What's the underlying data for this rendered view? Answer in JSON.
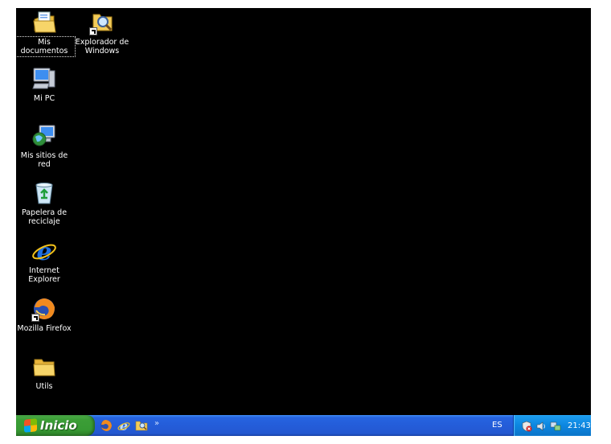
{
  "desktop": {
    "icons": [
      {
        "label": "Mis documentos",
        "icon": "my-documents-icon"
      },
      {
        "label": "Explorador de\nWindows",
        "icon": "windows-explorer-icon"
      },
      {
        "label": "Mi PC",
        "icon": "my-computer-icon"
      },
      {
        "label": "Mis sitios de red",
        "icon": "network-places-icon"
      },
      {
        "label": "Papelera de\nreciclaje",
        "icon": "recycle-bin-icon"
      },
      {
        "label": "Internet\nExplorer",
        "icon": "internet-explorer-icon"
      },
      {
        "label": "Mozilla Firefox",
        "icon": "firefox-icon"
      },
      {
        "label": "Utils",
        "icon": "folder-icon"
      }
    ]
  },
  "taskbar": {
    "start_label": "Inicio",
    "quick_launch": [
      "firefox-icon",
      "internet-explorer-icon",
      "windows-explorer-icon"
    ],
    "chevron": "»",
    "language": "ES",
    "clock": "21:43",
    "tray_icons": [
      "security-alert-icon",
      "speaker-icon",
      "network-icon"
    ]
  },
  "colors": {
    "desktop": "#000000",
    "taskbar": "#245dd9",
    "start": "#3c9e37",
    "tray": "#0c86e0"
  }
}
